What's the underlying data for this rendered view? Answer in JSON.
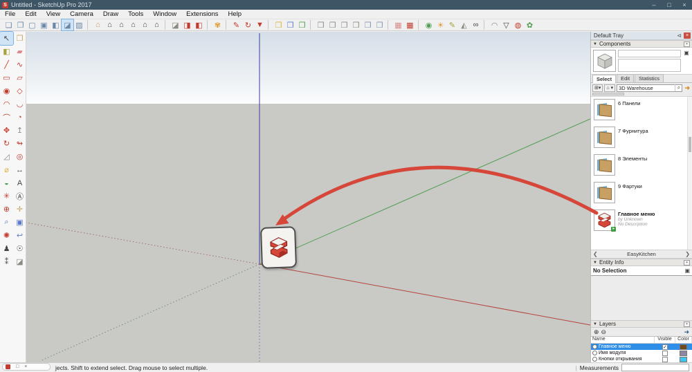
{
  "window": {
    "title": "Untitled - SketchUp Pro 2017",
    "logo": "S",
    "minimize": "–",
    "maximize": "□",
    "close": "×"
  },
  "menu": {
    "items": [
      "File",
      "Edit",
      "View",
      "Camera",
      "Draw",
      "Tools",
      "Window",
      "Extensions",
      "Help"
    ]
  },
  "toolbar": {
    "items": [
      {
        "n": "x-ray-icon",
        "g": "❏",
        "cls": "c-steel"
      },
      {
        "n": "back-edges-icon",
        "g": "❐",
        "cls": "c-steel"
      },
      {
        "n": "wireframe-icon",
        "g": "▢",
        "cls": "c-steel"
      },
      {
        "n": "hidden-line-icon",
        "g": "▣",
        "cls": "c-steel"
      },
      {
        "n": "shaded-icon",
        "g": "◧",
        "cls": "c-steel"
      },
      {
        "n": "shaded-with-textures-icon",
        "g": "◪",
        "cls": "c-steel active"
      },
      {
        "n": "monochrome-icon",
        "g": "▨",
        "cls": "c-steel"
      },
      {
        "n": "separator",
        "g": "",
        "cls": "sep"
      },
      {
        "n": "iso-view-icon",
        "g": "⌂",
        "cls": "c-tan"
      },
      {
        "n": "top-view-icon",
        "g": "⌂",
        "cls": "c-dark"
      },
      {
        "n": "front-view-icon",
        "g": "⌂",
        "cls": "c-dark"
      },
      {
        "n": "right-view-icon",
        "g": "⌂",
        "cls": "c-dark"
      },
      {
        "n": "back-view-icon",
        "g": "⌂",
        "cls": "c-dark"
      },
      {
        "n": "left-view-icon",
        "g": "⌂",
        "cls": "c-dark"
      },
      {
        "n": "separator",
        "g": "",
        "cls": "sep"
      },
      {
        "n": "section-plane-icon",
        "g": "◪",
        "cls": "c-gray"
      },
      {
        "n": "display-section-planes-icon",
        "g": "◨",
        "cls": "c-red"
      },
      {
        "n": "display-section-cuts-icon",
        "g": "◧",
        "cls": "c-red"
      },
      {
        "n": "separator",
        "g": "",
        "cls": "sep"
      },
      {
        "n": "paint-swirl-icon",
        "g": "✾",
        "cls": "c-orange"
      },
      {
        "n": "separator",
        "g": "",
        "cls": "sep"
      },
      {
        "n": "draw-pencil-icon",
        "g": "✎",
        "cls": "c-red"
      },
      {
        "n": "refresh-arrows-icon",
        "g": "↻",
        "cls": "c-red"
      },
      {
        "n": "su-funnel-icon",
        "g": "▼",
        "cls": "c-red"
      },
      {
        "n": "separator",
        "g": "",
        "cls": "sep"
      },
      {
        "n": "box-yellow-icon",
        "g": "❒",
        "cls": "c-yellow"
      },
      {
        "n": "box-blue-icon",
        "g": "❒",
        "cls": "c-blue"
      },
      {
        "n": "box-green-icon",
        "g": "❒",
        "cls": "c-green"
      },
      {
        "n": "separator",
        "g": "",
        "cls": "sep"
      },
      {
        "n": "module-box-icon",
        "g": "❒",
        "cls": "c-gray"
      },
      {
        "n": "module-box-icon",
        "g": "❒",
        "cls": "c-gray"
      },
      {
        "n": "module-box-icon",
        "g": "❒",
        "cls": "c-gray"
      },
      {
        "n": "module-box-icon",
        "g": "❒",
        "cls": "c-gray"
      },
      {
        "n": "module-box-icon",
        "g": "❒",
        "cls": "c-bluegray"
      },
      {
        "n": "module-box-icon",
        "g": "❒",
        "cls": "c-bluegray"
      },
      {
        "n": "separator",
        "g": "",
        "cls": "sep"
      },
      {
        "n": "panel-pink-icon",
        "g": "▦",
        "cls": "c-pink"
      },
      {
        "n": "panel-pink-icon",
        "g": "▦",
        "cls": "c-red"
      },
      {
        "n": "separator",
        "g": "",
        "cls": "sep"
      },
      {
        "n": "green-sphere-icon",
        "g": "◉",
        "cls": "c-green"
      },
      {
        "n": "shadows-sun-icon",
        "g": "☀",
        "cls": "c-orange"
      },
      {
        "n": "pencil-ruler-icon",
        "g": "✎",
        "cls": "c-olive"
      },
      {
        "n": "rock-icon",
        "g": "◭",
        "cls": "c-gray"
      },
      {
        "n": "binoculars-icon",
        "g": "∞",
        "cls": "c-dark"
      },
      {
        "n": "separator",
        "g": "",
        "cls": "sep"
      },
      {
        "n": "curve-icon",
        "g": "◠",
        "cls": "c-gray"
      },
      {
        "n": "shield-icon",
        "g": "▽",
        "cls": "c-dark"
      },
      {
        "n": "bucket-icon",
        "g": "◍",
        "cls": "c-red"
      },
      {
        "n": "leaf-icon",
        "g": "✿",
        "cls": "c-green"
      }
    ]
  },
  "palette": {
    "tools": [
      {
        "n": "select-tool",
        "g": "↖",
        "cls": "c-dark active"
      },
      {
        "n": "make-component-tool",
        "g": "❒",
        "cls": "c-tan"
      },
      {
        "n": "paint-bucket-tool",
        "g": "◧",
        "cls": "c-olive"
      },
      {
        "n": "eraser-tool",
        "g": "▰",
        "cls": "c-pink"
      },
      {
        "n": "line-tool",
        "g": "╱",
        "cls": "c-red"
      },
      {
        "n": "freehand-tool",
        "g": "∿",
        "cls": "c-red"
      },
      {
        "n": "rectangle-tool",
        "g": "▭",
        "cls": "c-red"
      },
      {
        "n": "rotated-rectangle-tool",
        "g": "▱",
        "cls": "c-red"
      },
      {
        "n": "circle-tool",
        "g": "◉",
        "cls": "c-red"
      },
      {
        "n": "polygon-tool",
        "g": "◇",
        "cls": "c-red"
      },
      {
        "n": "arc-tool",
        "g": "◠",
        "cls": "c-red"
      },
      {
        "n": "two-point-arc-tool",
        "g": "◡",
        "cls": "c-red"
      },
      {
        "n": "three-point-arc-tool",
        "g": "⌒",
        "cls": "c-red"
      },
      {
        "n": "pie-tool",
        "g": "◔",
        "cls": "c-red"
      },
      {
        "n": "move-tool",
        "g": "✥",
        "cls": "c-red"
      },
      {
        "n": "push-pull-tool",
        "g": "↥",
        "cls": "c-gray"
      },
      {
        "n": "rotate-tool",
        "g": "↻",
        "cls": "c-red"
      },
      {
        "n": "follow-me-tool",
        "g": "↬",
        "cls": "c-red"
      },
      {
        "n": "scale-tool",
        "g": "◿",
        "cls": "c-gray"
      },
      {
        "n": "offset-tool",
        "g": "◎",
        "cls": "c-red"
      },
      {
        "n": "tape-measure-tool",
        "g": "⌀",
        "cls": "c-yellow"
      },
      {
        "n": "dimensions-tool",
        "g": "↔",
        "cls": "c-dark"
      },
      {
        "n": "protractor-tool",
        "g": "◒",
        "cls": "c-green"
      },
      {
        "n": "text-tool",
        "g": "A",
        "cls": "c-dark"
      },
      {
        "n": "axes-tool",
        "g": "✳",
        "cls": "c-red"
      },
      {
        "n": "3d-text-tool",
        "g": "Ⓐ",
        "cls": "c-dark"
      },
      {
        "n": "orbit-tool",
        "g": "⊕",
        "cls": "c-red"
      },
      {
        "n": "pan-tool",
        "g": "✛",
        "cls": "c-tan"
      },
      {
        "n": "zoom-tool",
        "g": "⌕",
        "cls": "c-blue"
      },
      {
        "n": "zoom-window-tool",
        "g": "▣",
        "cls": "c-blue"
      },
      {
        "n": "zoom-extents-tool",
        "g": "✺",
        "cls": "c-red"
      },
      {
        "n": "previous-view-tool",
        "g": "↩",
        "cls": "c-blue"
      },
      {
        "n": "position-camera-tool",
        "g": "♟",
        "cls": "c-dark"
      },
      {
        "n": "look-around-tool",
        "g": "☉",
        "cls": "c-dark"
      },
      {
        "n": "walk-tool",
        "g": "⁑",
        "cls": "c-dark"
      },
      {
        "n": "section-plane-tool",
        "g": "◪",
        "cls": "c-gray"
      }
    ]
  },
  "tray": {
    "title": "Default Tray",
    "pin": "⊲",
    "close": "×"
  },
  "components": {
    "header": "Components",
    "options_glyph": "▪",
    "pane_toggle_glyph": "▣",
    "tabs": [
      {
        "label": "Select",
        "cls": "active"
      },
      {
        "label": "Edit",
        "cls": ""
      },
      {
        "label": "Statistics",
        "cls": ""
      }
    ],
    "view_btn": "⊞▾",
    "home_btn": "⌂ ▾",
    "search_value": "3D Warehouse",
    "search_icon": "⌕",
    "next_icon": "➜",
    "items": [
      {
        "label": "6 Панели",
        "by": "",
        "desc": "",
        "type": "folder",
        "bold": ""
      },
      {
        "label": "7 Фурнитура",
        "by": "",
        "desc": "",
        "type": "folder",
        "bold": ""
      },
      {
        "label": "8 Элементы",
        "by": "",
        "desc": "",
        "type": "folder",
        "bold": ""
      },
      {
        "label": "9 Фартуки",
        "by": "",
        "desc": "",
        "type": "folder",
        "bold": ""
      },
      {
        "label": "Главное меню",
        "by": "by Unknown",
        "desc": "No Description",
        "type": "logo",
        "bold": "bold"
      }
    ],
    "nav": {
      "prev": "❮",
      "label": "EasyKitchen",
      "next": "❯"
    }
  },
  "entity_info": {
    "header": "Entity Info",
    "options_glyph": "▪",
    "content": "No Selection",
    "icon_glyph": "▣"
  },
  "layers": {
    "header": "Layers",
    "options_glyph": "▪",
    "add_glyph": "⊕",
    "remove_glyph": "⊖",
    "detail_glyph": "➜",
    "columns": {
      "name": "Name",
      "visible": "Visible",
      "color": "Color"
    },
    "rows": [
      {
        "name": "Главное меню",
        "check": "✓",
        "color": "#6f4a21",
        "sel": "selected"
      },
      {
        "name": "Имя модуля",
        "check": "",
        "color": "#8d87a2",
        "sel": ""
      },
      {
        "name": "Кнопки открывания",
        "check": "",
        "color": "#3fc4ee",
        "sel": ""
      }
    ]
  },
  "status": {
    "text": "jects. Shift to extend select. Drag mouse to select multiple.",
    "mini_restore": "□",
    "mini_close": "×",
    "divider": "|",
    "measurements_label": "Measurements",
    "measurements_value": ""
  },
  "colors": {
    "accent_red": "#d6473a",
    "axis_green": "#4f9e4f",
    "axis_red": "#b5443c",
    "axis_blue": "#3a3a9e",
    "selection_blue": "#2f8fe8"
  }
}
